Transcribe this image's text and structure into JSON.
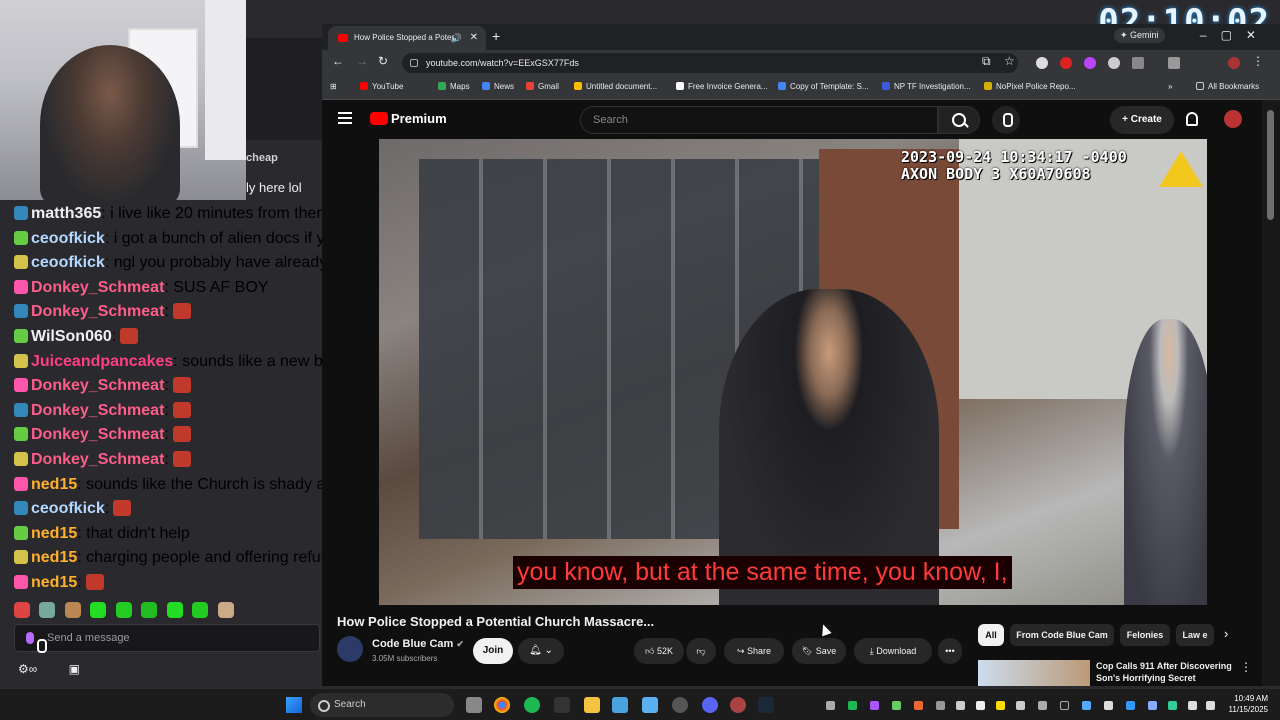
{
  "stream": {
    "timer": "02:10:02",
    "chat_partial_top": [
      "cheap",
      "ly here lol"
    ]
  },
  "chat": {
    "messages": [
      {
        "user": "matth365",
        "sep": ":",
        "text": " i live like 20 minutes from there",
        "color": "#efeff1"
      },
      {
        "user": "ceoofkick",
        "sep": ":",
        "text": " i got a bunch of alien docs if y",
        "color": "#b2d8ff"
      },
      {
        "user": "ceoofkick",
        "sep": ":",
        "text": " ngl you probably have already",
        "color": "#b2d8ff"
      },
      {
        "user": "Donkey_Schmeat",
        "sep": ":",
        "text": " SUS AF BOY",
        "color": "#ff5c8a"
      },
      {
        "user": "Donkey_Schmeat",
        "sep": ":",
        "text": "",
        "color": "#ff5c8a"
      },
      {
        "user": "WilSon060",
        "sep": ":",
        "text": "",
        "color": "#efeff1"
      },
      {
        "user": "Juiceandpancakes",
        "sep": ":",
        "text": " sounds like a new babaylon m",
        "color": "#ff3f7f"
      },
      {
        "user": "Donkey_Schmeat",
        "sep": ":",
        "text": "",
        "color": "#ff5c8a"
      },
      {
        "user": "Donkey_Schmeat",
        "sep": ":",
        "text": "",
        "color": "#ff5c8a"
      },
      {
        "user": "Donkey_Schmeat",
        "sep": ":",
        "text": "",
        "color": "#ff5c8a"
      },
      {
        "user": "Donkey_Schmeat",
        "sep": ":",
        "text": "",
        "color": "#ff5c8a"
      },
      {
        "user": "ned15",
        "sep": ":",
        "text": " sounds like the Church is shady af as we",
        "color": "#ffb12b"
      },
      {
        "user": "ceoofkick",
        "sep": ":",
        "text": "",
        "color": "#b2d8ff"
      },
      {
        "user": "ned15",
        "sep": ":",
        "text": " that didn't help",
        "color": "#ffb12b"
      },
      {
        "user": "ned15",
        "sep": ":",
        "text": " charging people and offering refunds if t",
        "color": "#ffb12b"
      },
      {
        "user": "ned15",
        "sep": ":",
        "text": "",
        "color": "#ffb12b"
      }
    ],
    "input_placeholder": "Send a message",
    "footer_icons": [
      "chat-settings-icon",
      "gift-icon"
    ]
  },
  "browser": {
    "tab_title": "How Police Stopped a Poten",
    "tab_close": "✕",
    "new_tab": "+",
    "gemini_label": "Gemini",
    "url": "youtube.com/watch?v=EExGSX77Fds",
    "bookmarks": [
      {
        "label": "YouTube",
        "color": "#ff0000"
      },
      {
        "label": "Maps",
        "color": "#34a853"
      },
      {
        "label": "News",
        "color": "#4285f4"
      },
      {
        "label": "Gmail",
        "color": "#ea4335"
      },
      {
        "label": "Untitled document...",
        "color": "#fbbc04"
      },
      {
        "label": "Free Invoice Genera...",
        "color": "#ffffff"
      },
      {
        "label": "Copy of Template: S...",
        "color": "#4285f4"
      },
      {
        "label": "NP TF Investigation...",
        "color": "#3b5bdb"
      },
      {
        "label": "NoPixel Police Repo...",
        "color": "#d4b106"
      }
    ],
    "bookmarks_more": "»",
    "all_bookmarks": "All Bookmarks"
  },
  "youtube": {
    "logo_text": "Premium",
    "search_placeholder": "Search",
    "create_label": "Create",
    "video": {
      "timestamp_line1": "2023-09-24 10:34:17 -0400",
      "timestamp_line2": "AXON BODY 3 X60A70608",
      "caption": "you know, but at the same time, you know, I,"
    },
    "title": "How Police Stopped a Potential Church Massacre...",
    "channel": {
      "name": "Code Blue Cam",
      "verified": "✔",
      "subscribers": "3.05M subscribers"
    },
    "join_label": "Join",
    "likes": "52K",
    "share_label": "Share",
    "save_label": "Save",
    "download_label": "Download",
    "more_label": "•••",
    "chips": [
      "All",
      "From Code Blue Cam",
      "Felonies",
      "Law e"
    ],
    "recommendation": {
      "title": "Cop Calls 911 After Discovering Son's Horrifying Secret"
    }
  },
  "taskbar": {
    "search_label": "Search",
    "time": "10:49 AM",
    "date": "11/15/2025"
  }
}
